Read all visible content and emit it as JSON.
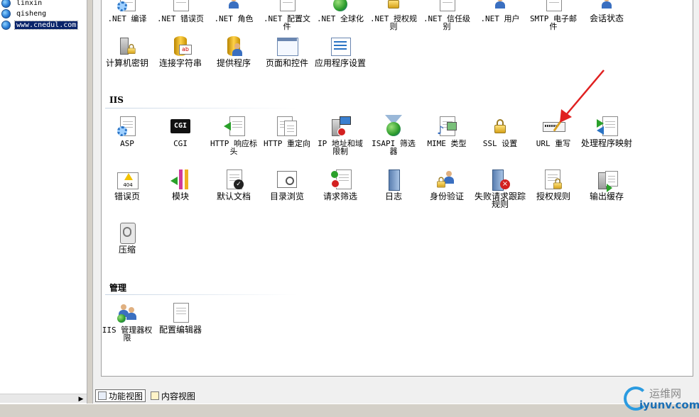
{
  "tree": {
    "items": [
      {
        "label": "linxin"
      },
      {
        "label": "qisheng"
      },
      {
        "label": "www.cnedul.com"
      }
    ]
  },
  "aspnet_row1": [
    {
      "label": ".NET 编译",
      "icon": "net-compile-icon"
    },
    {
      "label": ".NET 错误页",
      "icon": "net-error-pages-icon"
    },
    {
      "label": ".NET 角色",
      "icon": "net-roles-icon"
    },
    {
      "label": ".NET 配置文件",
      "icon": "net-profile-icon"
    },
    {
      "label": ".NET 全球化",
      "icon": "net-globalization-icon"
    },
    {
      "label": ".NET 授权规则",
      "icon": "net-authorization-icon"
    },
    {
      "label": ".NET 信任级别",
      "icon": "net-trust-levels-icon"
    },
    {
      "label": ".NET 用户",
      "icon": "net-users-icon"
    },
    {
      "label": "SMTP 电子邮件",
      "icon": "smtp-email-icon"
    },
    {
      "label": "会话状态",
      "icon": "session-state-icon"
    }
  ],
  "aspnet_row2": [
    {
      "label": "计算机密钥",
      "icon": "machine-key-icon"
    },
    {
      "label": "连接字符串",
      "icon": "connection-strings-icon"
    },
    {
      "label": "提供程序",
      "icon": "providers-icon"
    },
    {
      "label": "页面和控件",
      "icon": "pages-controls-icon"
    },
    {
      "label": "应用程序设置",
      "icon": "app-settings-icon"
    }
  ],
  "iis": {
    "title": "IIS",
    "row1": [
      {
        "label": "ASP",
        "icon": "asp-icon"
      },
      {
        "label": "CGI",
        "icon": "cgi-icon",
        "badge": "CGI"
      },
      {
        "label": "HTTP 响应标头",
        "icon": "http-headers-icon"
      },
      {
        "label": "HTTP 重定向",
        "icon": "http-redirect-icon"
      },
      {
        "label": "IP 地址和域限制",
        "icon": "ip-restrictions-icon"
      },
      {
        "label": "ISAPI 筛选器",
        "icon": "isapi-filters-icon"
      },
      {
        "label": "MIME 类型",
        "icon": "mime-types-icon"
      },
      {
        "label": "SSL 设置",
        "icon": "ssl-settings-icon"
      },
      {
        "label": "URL 重写",
        "icon": "url-rewrite-icon"
      },
      {
        "label": "处理程序映射",
        "icon": "handler-mappings-icon"
      }
    ],
    "row2": [
      {
        "label": "错误页",
        "icon": "error-pages-icon",
        "badge": "404"
      },
      {
        "label": "模块",
        "icon": "modules-icon"
      },
      {
        "label": "默认文档",
        "icon": "default-document-icon"
      },
      {
        "label": "目录浏览",
        "icon": "directory-browsing-icon"
      },
      {
        "label": "请求筛选",
        "icon": "request-filtering-icon"
      },
      {
        "label": "日志",
        "icon": "logging-icon"
      },
      {
        "label": "身份验证",
        "icon": "authentication-icon"
      },
      {
        "label": "失败请求跟踪规则",
        "icon": "failed-request-tracing-icon"
      },
      {
        "label": "授权规则",
        "icon": "authorization-rules-icon"
      },
      {
        "label": "输出缓存",
        "icon": "output-caching-icon"
      }
    ],
    "row3": [
      {
        "label": "压缩",
        "icon": "compression-icon"
      }
    ]
  },
  "management": {
    "title": "管理",
    "row1": [
      {
        "label": "IIS 管理器权限",
        "icon": "iis-manager-permissions-icon"
      },
      {
        "label": "配置编辑器",
        "icon": "configuration-editor-icon"
      }
    ]
  },
  "views": {
    "features": "功能视图",
    "content": "内容视图"
  },
  "watermark": {
    "line1": "运维网",
    "line2": "iyunv.com"
  },
  "colors": {
    "selection": "#0a246a",
    "annotation_arrow": "#e02020",
    "watermark_blue": "#1a6fb5"
  }
}
